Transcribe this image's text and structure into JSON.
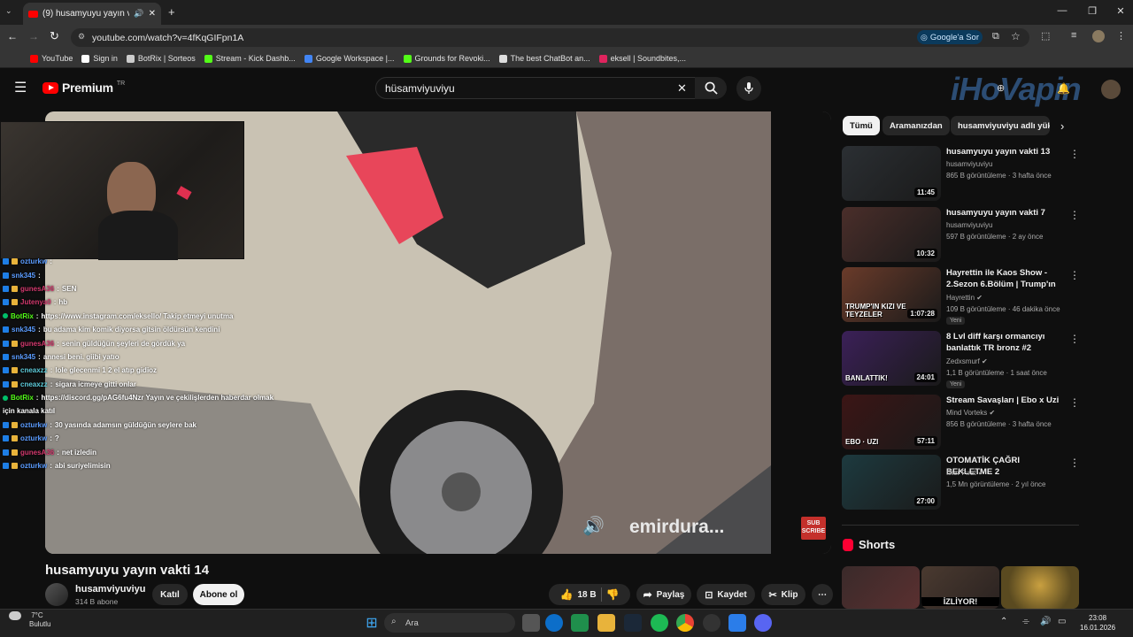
{
  "browser": {
    "tab_title": "(9) husamyuyu yayın vakti 1",
    "url": "youtube.com/watch?v=4fKqGIFpn1A",
    "google_ask": "Google'a Sor",
    "bookmarks": [
      {
        "label": "YouTube",
        "color": "#ff0000"
      },
      {
        "label": "Sign in",
        "color": "#ffffff"
      },
      {
        "label": "BotRix | Sorteos",
        "color": "#cccccc"
      },
      {
        "label": "Stream - Kick Dashb...",
        "color": "#53fc18"
      },
      {
        "label": "Google Workspace |...",
        "color": "#4285f4"
      },
      {
        "label": "Grounds for Revoki...",
        "color": "#53fc18"
      },
      {
        "label": "The best ChatBot an...",
        "color": "#dddddd"
      },
      {
        "label": "eksell | Soundbites,...",
        "color": "#e0245e"
      }
    ]
  },
  "youtube": {
    "logo_text": "Premium",
    "logo_sup": "TR",
    "search_value": "hüsamviyuviyu",
    "watermark": "iHoVapin"
  },
  "video": {
    "overlay_text": "emirdura...",
    "subscribe_badge": "SUB SCRIBE",
    "title": "husamyuyu yayın vakti 14",
    "channel": "husamviyuviyu",
    "subscribers": "314 B abone",
    "join_label": "Katıl",
    "subscribe_label": "Abone ol",
    "likes": "18 B",
    "share_label": "Paylaş",
    "save_label": "Kaydet",
    "clip_label": "Klip"
  },
  "chat": [
    {
      "user": "ozturkw",
      "msg": "",
      "color": "#5b9cff"
    },
    {
      "user": "snk345",
      "msg": "",
      "color": "#5b9cff"
    },
    {
      "user": "gunesA36",
      "msg": "SEN",
      "color": "#d2386d"
    },
    {
      "user": "Jutenya0",
      "msg": "hb",
      "color": "#d2386d"
    },
    {
      "user": "BotRix",
      "msg": "https://www.instagram.com/eksello/ Takip etmeyi unutma",
      "color": "#53fc18"
    },
    {
      "user": "snk345",
      "msg": "bu adama kim komik diyorsa gitsin öldürsün kendini",
      "color": "#5b9cff"
    },
    {
      "user": "gunesA36",
      "msg": "senin güldüğün şeyleri de gördük ya",
      "color": "#d2386d"
    },
    {
      "user": "snk345",
      "msg": "annesi beni. giibi yatıo",
      "color": "#5b9cff"
    },
    {
      "user": "cneaxzz",
      "msg": "lole glecenmi 1 2 el atıp gidioz",
      "color": "#5cc9d8"
    },
    {
      "user": "cneaxzz",
      "msg": "sigara icmeye gitti onlar",
      "color": "#5cc9d8"
    },
    {
      "user": "BotRix",
      "msg": "https://discord.gg/pAG6fu4Nzr Yayın ve çekilişlerden haberdar olmak",
      "color": "#53fc18"
    },
    {
      "user": "",
      "msg": "için kanala katıl",
      "color": "#ffffff"
    },
    {
      "user": "ozturkw",
      "msg": "30 yasında adamsın güldüğün seylere bak",
      "color": "#5b9cff"
    },
    {
      "user": "ozturkw",
      "msg": "?",
      "color": "#5b9cff"
    },
    {
      "user": "gunesA36",
      "msg": "net izledin",
      "color": "#d2386d"
    },
    {
      "user": "ozturkw",
      "msg": "abi suriyelimisin",
      "color": "#5b9cff"
    }
  ],
  "chips": [
    "Tümü",
    "Aramanızdan",
    "husamviyuviyu adlı yükle"
  ],
  "related": [
    {
      "title": "husamyuyu yayın vakti 13",
      "channel": "husamviyuviyu",
      "verified": false,
      "meta": "865 B görüntüleme · 3 hafta önce",
      "duration": "11:45",
      "new": "",
      "bg": "#2b2f33"
    },
    {
      "title": "husamyuyu yayın vakti 7",
      "channel": "husamviyuviyu",
      "verified": false,
      "meta": "597 B görüntüleme · 2 ay önce",
      "duration": "10:32",
      "new": "",
      "bg": "#4a2e2a"
    },
    {
      "title": "Hayrettin ile Kaos Show - 2.Sezon 6.Bölüm | Trump'ın Kı...",
      "channel": "Hayrettin",
      "verified": true,
      "meta": "109 B görüntüleme · 46 dakika önce",
      "duration": "1:07:28",
      "new": "Yeni",
      "bg": "#6a3b2a"
    },
    {
      "title": "8 Lvl diff karşı ormancıyı banlattık TR bronz #2",
      "channel": "Zedxsmurf",
      "verified": true,
      "meta": "1,1 B görüntüleme · 1 saat önce",
      "duration": "24:01",
      "new": "Yeni",
      "bg": "#3b2058"
    },
    {
      "title": "Stream Savaşları | Ebo x Uzi",
      "channel": "Mind Vorteks",
      "verified": true,
      "meta": "856 B görüntüleme · 3 hafta önce",
      "duration": "57:11",
      "new": "",
      "bg": "#3b1515"
    },
    {
      "title": "OTOMATİK ÇAĞRI BEKLETME 2",
      "channel": "İlker Fırat",
      "verified": true,
      "meta": "1,5 Mn görüntüleme · 2 yıl önce",
      "duration": "27:00",
      "new": "",
      "bg": "#1d3a3f"
    }
  ],
  "thumb_text": {
    "r2": "TRUMP'IN KIZI VE TEYZELER",
    "r3": "BANLATTIK!",
    "r4": "EBO · UZI"
  },
  "shorts": {
    "title": "Shorts",
    "badge": "İZLİYOR!"
  },
  "taskbar": {
    "temp": "7°C",
    "weather": "Bulutlu",
    "search": "Ara",
    "time": "23:08",
    "date": "16.01.2026"
  }
}
